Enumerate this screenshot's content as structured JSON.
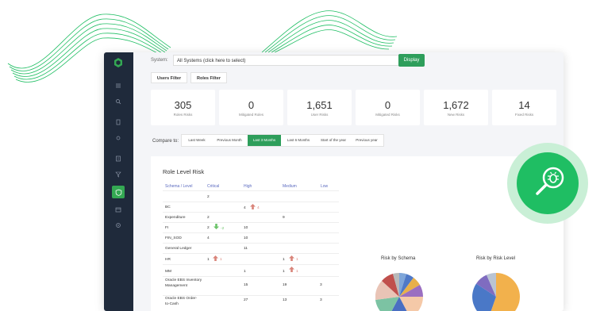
{
  "system": {
    "label": "System:",
    "value": "All Systems (click here to select)",
    "display_button": "Display"
  },
  "filters": {
    "users": "Users Filter",
    "roles": "Roles Filter"
  },
  "stats": [
    {
      "value": "305",
      "label": "Roles Risks"
    },
    {
      "value": "0",
      "label": "Mitigated Roles"
    },
    {
      "value": "1,651",
      "label": "User Risks"
    },
    {
      "value": "0",
      "label": "Mitigated Risks"
    },
    {
      "value": "1,672",
      "label": "New Risks"
    },
    {
      "value": "14",
      "label": "Fixed Risks"
    }
  ],
  "compare": {
    "label": "Compare to:",
    "options": [
      "Last Week",
      "Previous Month",
      "Last 3 Months",
      "Last 6 Months",
      "Start of the year",
      "Previous year"
    ],
    "selected": "Last 3 Months"
  },
  "role_level_risk": {
    "title": "Role Level Risk",
    "columns": [
      "Schema / Level",
      "Critical",
      "High",
      "Medium",
      "Low"
    ],
    "rows": [
      {
        "name": "",
        "critical": "2",
        "high": "",
        "medium": "",
        "low": ""
      },
      {
        "name": "BC",
        "critical": "",
        "high": "4",
        "high_change": "4",
        "medium": "",
        "low": ""
      },
      {
        "name": "Expenditure",
        "critical": "2",
        "high": "",
        "medium": "9",
        "low": ""
      },
      {
        "name": "FI",
        "critical": "2",
        "critical_change": "-2",
        "high": "10",
        "medium": "",
        "low": ""
      },
      {
        "name": "FIN_SOD",
        "critical": "4",
        "high": "10",
        "medium": "",
        "low": ""
      },
      {
        "name": "General Ledger",
        "critical": "",
        "high": "11",
        "medium": "",
        "low": ""
      },
      {
        "name": "HR",
        "critical": "1",
        "critical_change": "1",
        "high": "",
        "medium": "1",
        "medium_change": "1",
        "low": ""
      },
      {
        "name": "MM",
        "critical": "",
        "high": "1",
        "medium": "1",
        "medium_change": "1",
        "low": ""
      },
      {
        "name": "Oracle EBS Inventory Management",
        "critical": "",
        "high": "15",
        "medium": "19",
        "low": "3"
      },
      {
        "name": "Oracle EBS Order-to-Cash",
        "critical": "",
        "high": "27",
        "medium": "13",
        "low": "3"
      }
    ]
  },
  "charts": {
    "schema_title": "Risk by Schema",
    "level_title": "Risk by Risk Level"
  },
  "colors": {
    "accent": "#2e9e5b",
    "sidebar": "#1f2a3b",
    "up_arrow": "#d9847a",
    "down_arrow": "#6cc36a",
    "bug_badge": "#1fbe63"
  },
  "icons": [
    "logo-icon",
    "menu-icon",
    "search-icon",
    "file-icon",
    "settings-icon",
    "document-icon",
    "filter-icon",
    "shield-icon",
    "calendar-icon",
    "gear-icon",
    "bug-search-icon"
  ]
}
